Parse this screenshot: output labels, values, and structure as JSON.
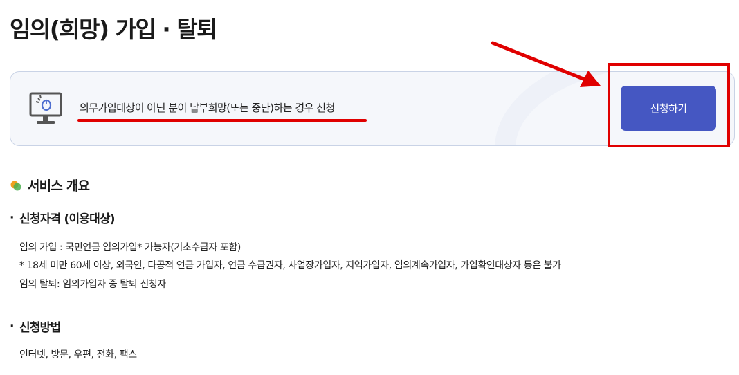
{
  "page": {
    "title": "임의(희망) 가입 · 탈퇴"
  },
  "banner": {
    "icon": "monitor-click-icon",
    "text": "의무가입대상이 아닌 분이 납부희망(또는 중단)하는 경우 신청",
    "button_label": "신청하기",
    "button_color": "#4557c2"
  },
  "annotations": {
    "color": "#e00000"
  },
  "overview": {
    "icon": "overlap-dots-icon",
    "title": "서비스 개요",
    "eligibility": {
      "bullet": "·",
      "title": "신청자격 (이용대상)",
      "lines": [
        "임의 가입 : 국민연금 임의가입* 가능자(기초수급자 포함)",
        "* 18세 미만 60세 이상, 외국인, 타공적 연금 가입자, 연금 수급권자, 사업장가입자, 지역가입자, 임의계속가입자, 가입확인대상자 등은 불가",
        "임의 탈퇴: 임의가입자 중 탈퇴 신청자"
      ]
    },
    "method": {
      "bullet": "·",
      "title": "신청방법",
      "lines": [
        "인터넷, 방문, 우편, 전화, 팩스"
      ]
    }
  }
}
